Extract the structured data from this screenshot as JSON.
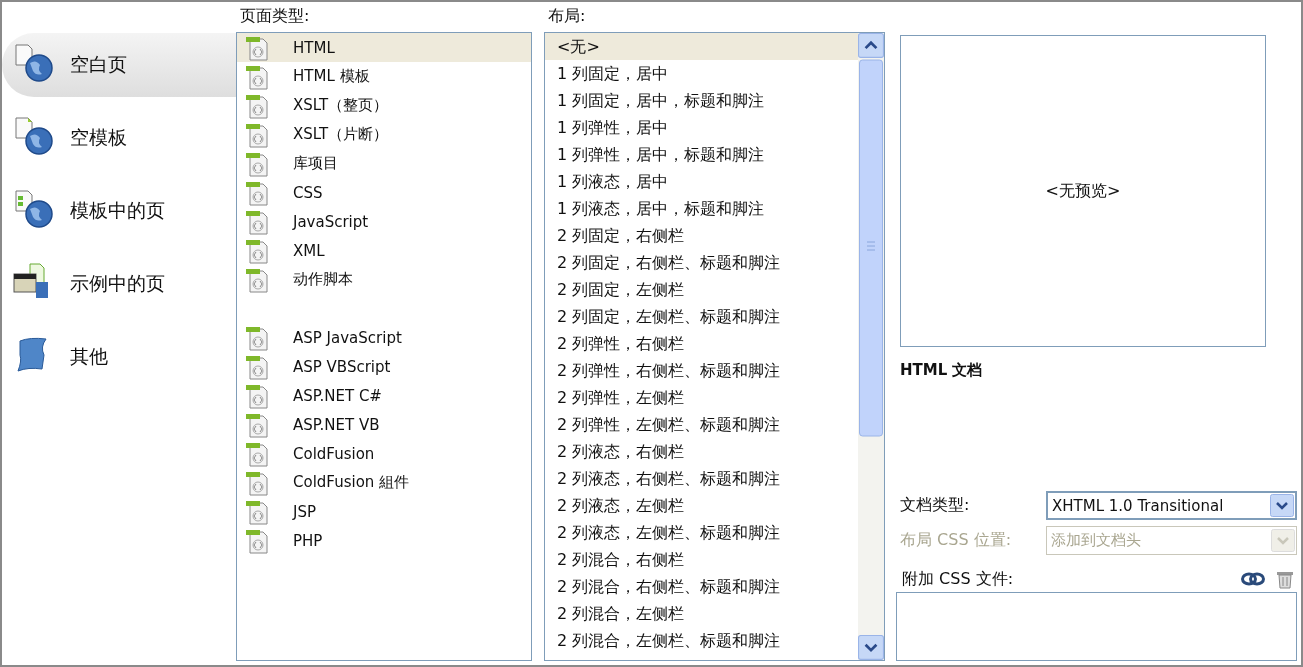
{
  "categories": [
    {
      "label": "空白页",
      "selected": true
    },
    {
      "label": "空模板",
      "selected": false
    },
    {
      "label": "模板中的页",
      "selected": false
    },
    {
      "label": "示例中的页",
      "selected": false
    },
    {
      "label": "其他",
      "selected": false
    }
  ],
  "page_types": {
    "label": "页面类型:",
    "groups": [
      [
        {
          "label": "HTML",
          "selected": true
        },
        {
          "label": "HTML 模板",
          "selected": false
        },
        {
          "label": "XSLT（整页）",
          "selected": false
        },
        {
          "label": "XSLT（片断）",
          "selected": false
        },
        {
          "label": "库项目",
          "selected": false
        },
        {
          "label": "CSS",
          "selected": false
        },
        {
          "label": "JavaScript",
          "selected": false
        },
        {
          "label": "XML",
          "selected": false
        },
        {
          "label": "动作脚本",
          "selected": false
        }
      ],
      [
        {
          "label": "ASP JavaScript",
          "selected": false
        },
        {
          "label": "ASP VBScript",
          "selected": false
        },
        {
          "label": "ASP.NET C#",
          "selected": false
        },
        {
          "label": "ASP.NET VB",
          "selected": false
        },
        {
          "label": "ColdFusion",
          "selected": false
        },
        {
          "label": "ColdFusion 組件",
          "selected": false
        },
        {
          "label": "JSP",
          "selected": false
        },
        {
          "label": "PHP",
          "selected": false
        }
      ]
    ]
  },
  "layouts": {
    "label": "布局:",
    "items": [
      {
        "label": "<无>",
        "selected": true
      },
      {
        "label": "1 列固定，居中",
        "selected": false
      },
      {
        "label": "1 列固定，居中，标题和脚注",
        "selected": false
      },
      {
        "label": "1 列弹性，居中",
        "selected": false
      },
      {
        "label": "1 列弹性，居中，标题和脚注",
        "selected": false
      },
      {
        "label": "1 列液态，居中",
        "selected": false
      },
      {
        "label": "1 列液态，居中，标题和脚注",
        "selected": false
      },
      {
        "label": "2 列固定，右侧栏",
        "selected": false
      },
      {
        "label": "2 列固定，右侧栏、标题和脚注",
        "selected": false
      },
      {
        "label": "2 列固定，左侧栏",
        "selected": false
      },
      {
        "label": "2 列固定，左侧栏、标题和脚注",
        "selected": false
      },
      {
        "label": "2 列弹性，右侧栏",
        "selected": false
      },
      {
        "label": "2 列弹性，右侧栏、标题和脚注",
        "selected": false
      },
      {
        "label": "2 列弹性，左侧栏",
        "selected": false
      },
      {
        "label": "2 列弹性，左侧栏、标题和脚注",
        "selected": false
      },
      {
        "label": "2 列液态，右侧栏",
        "selected": false
      },
      {
        "label": "2 列液态，右侧栏、标题和脚注",
        "selected": false
      },
      {
        "label": "2 列液态，左侧栏",
        "selected": false
      },
      {
        "label": "2 列液态，左侧栏、标题和脚注",
        "selected": false
      },
      {
        "label": "2 列混合，右侧栏",
        "selected": false
      },
      {
        "label": "2 列混合，右侧栏、标题和脚注",
        "selected": false
      },
      {
        "label": "2 列混合，左侧栏",
        "selected": false
      },
      {
        "label": "2 列混合，左侧栏、标题和脚注",
        "selected": false
      }
    ]
  },
  "preview": {
    "placeholder": "<无预览>",
    "description": "HTML 文档"
  },
  "fields": [
    {
      "label": "文档类型:",
      "value": "XHTML 1.0 Transitional",
      "disabled": false
    },
    {
      "label": "布局 CSS 位置:",
      "value": "添加到文档头",
      "disabled": true
    }
  ],
  "attach_css": {
    "label": "附加 CSS 文件:"
  }
}
